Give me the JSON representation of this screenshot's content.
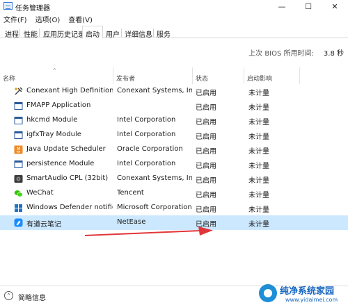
{
  "window": {
    "title": "任务管理器",
    "controls": {
      "minimize": "—",
      "maximize": "☐",
      "close": "✕"
    }
  },
  "menu": [
    "文件(F)",
    "选项(O)",
    "查看(V)"
  ],
  "tabs": [
    {
      "label": "进程",
      "active": false
    },
    {
      "label": "性能",
      "active": false
    },
    {
      "label": "应用历史记录",
      "active": false
    },
    {
      "label": "启动",
      "active": true
    },
    {
      "label": "用户",
      "active": false
    },
    {
      "label": "详细信息",
      "active": false
    },
    {
      "label": "服务",
      "active": false
    }
  ],
  "bios": {
    "label": "上次 BIOS 所用时间:",
    "value": "3.8 秒"
  },
  "columns": {
    "name": "名称",
    "publisher": "发布者",
    "status": "状态",
    "impact": "启动影响"
  },
  "rows": [
    {
      "name": "Conexant High Definition ...",
      "publisher": "Conexant Systems, Inc.",
      "status": "已启用",
      "impact": "未计量",
      "icon": "audio-tool-icon"
    },
    {
      "name": "FMAPP Application",
      "publisher": "",
      "status": "已启用",
      "impact": "未计量",
      "icon": "app-window-icon"
    },
    {
      "name": "hkcmd Module",
      "publisher": "Intel Corporation",
      "status": "已启用",
      "impact": "未计量",
      "icon": "app-window-icon"
    },
    {
      "name": "igfxTray Module",
      "publisher": "Intel Corporation",
      "status": "已启用",
      "impact": "未计量",
      "icon": "app-window-icon"
    },
    {
      "name": "Java Update Scheduler",
      "publisher": "Oracle Corporation",
      "status": "已启用",
      "impact": "未计量",
      "icon": "java-icon"
    },
    {
      "name": "persistence Module",
      "publisher": "Intel Corporation",
      "status": "已启用",
      "impact": "未计量",
      "icon": "app-window-icon"
    },
    {
      "name": "SmartAudio CPL (32bit)",
      "publisher": "Conexant Systems, Inc.",
      "status": "已启用",
      "impact": "未计量",
      "icon": "smartaudio-icon"
    },
    {
      "name": "WeChat",
      "publisher": "Tencent",
      "status": "已启用",
      "impact": "未计量",
      "icon": "wechat-icon"
    },
    {
      "name": "Windows Defender notific...",
      "publisher": "Microsoft Corporation",
      "status": "已启用",
      "impact": "未计量",
      "icon": "windows-defender-icon"
    },
    {
      "name": "有道云笔记",
      "publisher": "NetEase",
      "status": "已启用",
      "impact": "未计量",
      "icon": "youdao-note-icon",
      "selected": true
    }
  ],
  "footer": {
    "label": "简略信息"
  },
  "watermark": {
    "title": "纯净系统家园",
    "url": "www.yidaimei.com"
  },
  "colors": {
    "selection": "#cce8ff",
    "annotation_arrow": "#e0363a"
  }
}
